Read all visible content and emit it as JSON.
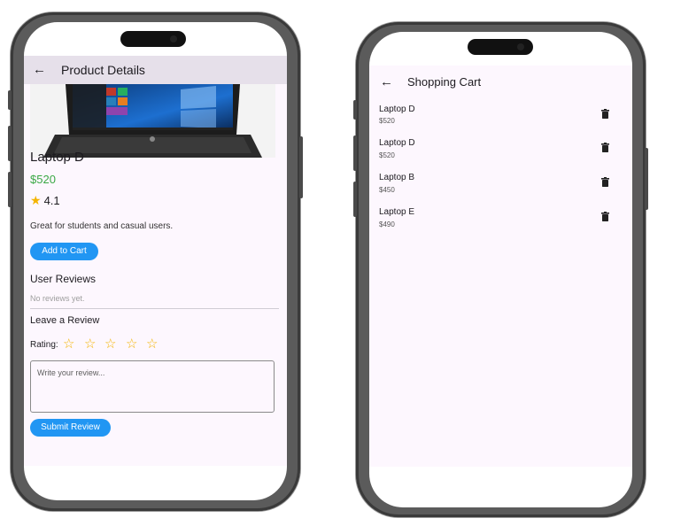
{
  "product_details": {
    "title": "Product Details",
    "product": {
      "name": "Laptop D",
      "price": "$520",
      "rating": "4.1",
      "description": "Great for students and casual users."
    },
    "add_to_cart_label": "Add to Cart",
    "user_reviews_heading": "User Reviews",
    "no_reviews_text": "No reviews yet.",
    "leave_review_heading": "Leave a Review",
    "rating_label": "Rating:",
    "rating_stars_total": 5,
    "rating_stars_selected": 0,
    "review_placeholder": "Write your review...",
    "submit_label": "Submit Review"
  },
  "shopping_cart": {
    "title": "Shopping Cart",
    "items": [
      {
        "name": "Laptop D",
        "price": "$520"
      },
      {
        "name": "Laptop D",
        "price": "$520"
      },
      {
        "name": "Laptop B",
        "price": "$450"
      },
      {
        "name": "Laptop E",
        "price": "$490"
      }
    ]
  },
  "colors": {
    "appbar": "#e6e0ea",
    "background": "#fdf7fe",
    "accent_button": "#2196f3",
    "price_green": "#3aa845",
    "star_gold": "#f4b400"
  },
  "icons": {
    "back": "arrow-left",
    "rating_star": "star-filled",
    "review_star": "star-outline",
    "delete": "trash"
  }
}
